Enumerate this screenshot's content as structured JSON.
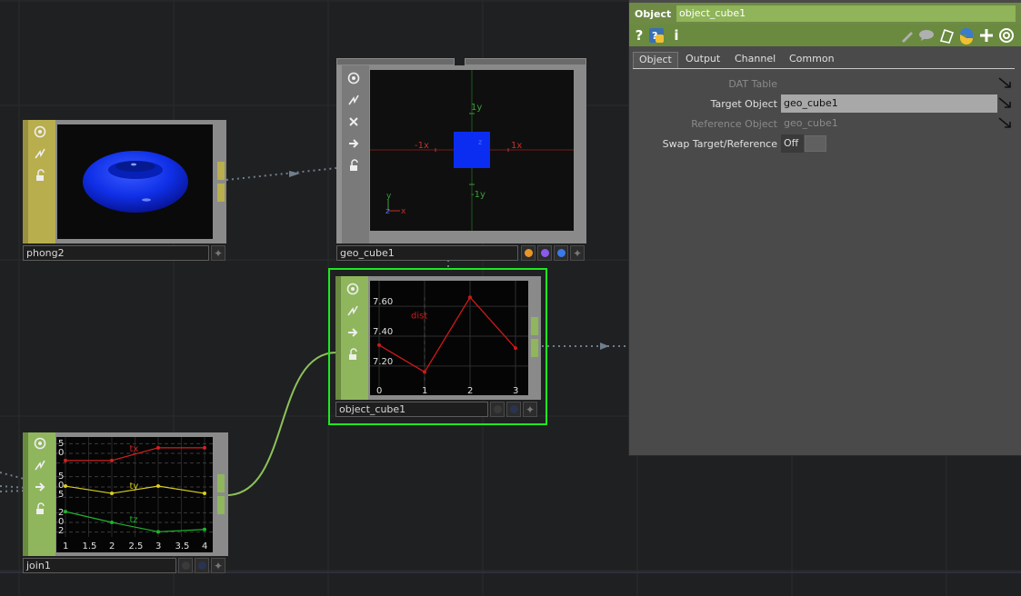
{
  "nodes": {
    "phong2": {
      "label": "phong2"
    },
    "geo_cube1": {
      "label": "geo_cube1",
      "axis_labels": {
        "pos_y": "1y",
        "neg_y": "-1y",
        "pos_x": "1x",
        "neg_x": "-1x",
        "z": "z"
      },
      "gizmo": {
        "y": "y",
        "z": "z",
        "x": "x"
      },
      "flag_colors": [
        "#e8962a",
        "#8a5ae8",
        "#3a7ae8"
      ]
    },
    "object_cube1": {
      "label": "object_cube1"
    },
    "join1": {
      "label": "join1"
    }
  },
  "panel": {
    "type_label": "Object",
    "name": "object_cube1",
    "tools_left": [
      "?",
      "?",
      "i"
    ],
    "tabs": [
      "Object",
      "Output",
      "Channel",
      "Common"
    ],
    "active_tab": "Object",
    "params": {
      "dat_table": {
        "label": "DAT Table",
        "value": ""
      },
      "target_object": {
        "label": "Target Object",
        "value": "geo_cube1"
      },
      "reference_object": {
        "label": "Reference Object",
        "value": "geo_cube1"
      },
      "swap": {
        "label": "Swap Target/Reference",
        "value": "Off"
      }
    }
  },
  "chart_data": [
    {
      "type": "line",
      "title": "",
      "series": [
        {
          "name": "dist",
          "x": [
            0,
            1,
            2,
            3
          ],
          "values": [
            7.34,
            7.16,
            7.66,
            7.32
          ]
        }
      ],
      "xticks": [
        "0",
        "1",
        "2",
        "3"
      ],
      "yticks": [
        "7.20",
        "7.40",
        "7.60"
      ],
      "xlim": [
        0,
        3
      ],
      "ylim": [
        7.09,
        7.71
      ],
      "color": "#d01818"
    },
    {
      "type": "line",
      "title": "",
      "x": [
        1,
        1.5,
        2,
        2.5,
        3,
        3.5,
        4
      ],
      "xticks": [
        "1",
        "1.5",
        "2",
        "2.5",
        "3",
        "3.5",
        "4"
      ],
      "series": [
        {
          "name": "tx",
          "x": [
            1,
            2,
            3,
            4
          ],
          "values": [
            -1.5,
            -1.5,
            2.5,
            2.5
          ],
          "color": "#d42020",
          "ticks": [
            "5",
            "0"
          ],
          "ylim": [
            -3.8,
            5.3
          ]
        },
        {
          "name": "ty",
          "x": [
            1,
            2,
            3,
            4
          ],
          "values": [
            0,
            -2.5,
            0,
            -2.5
          ],
          "color": "#d8cf20",
          "ticks": [
            "5",
            "0",
            "5"
          ],
          "ylim": [
            -5.6,
            5.0
          ]
        },
        {
          "name": "tz",
          "x": [
            1,
            2,
            3,
            4
          ],
          "values": [
            1.8,
            -0.5,
            -2.5,
            -2.0
          ],
          "color": "#1fb52a",
          "ticks": [
            "2",
            "0",
            "2"
          ],
          "ylim": [
            -3.6,
            2.6
          ]
        }
      ]
    }
  ]
}
